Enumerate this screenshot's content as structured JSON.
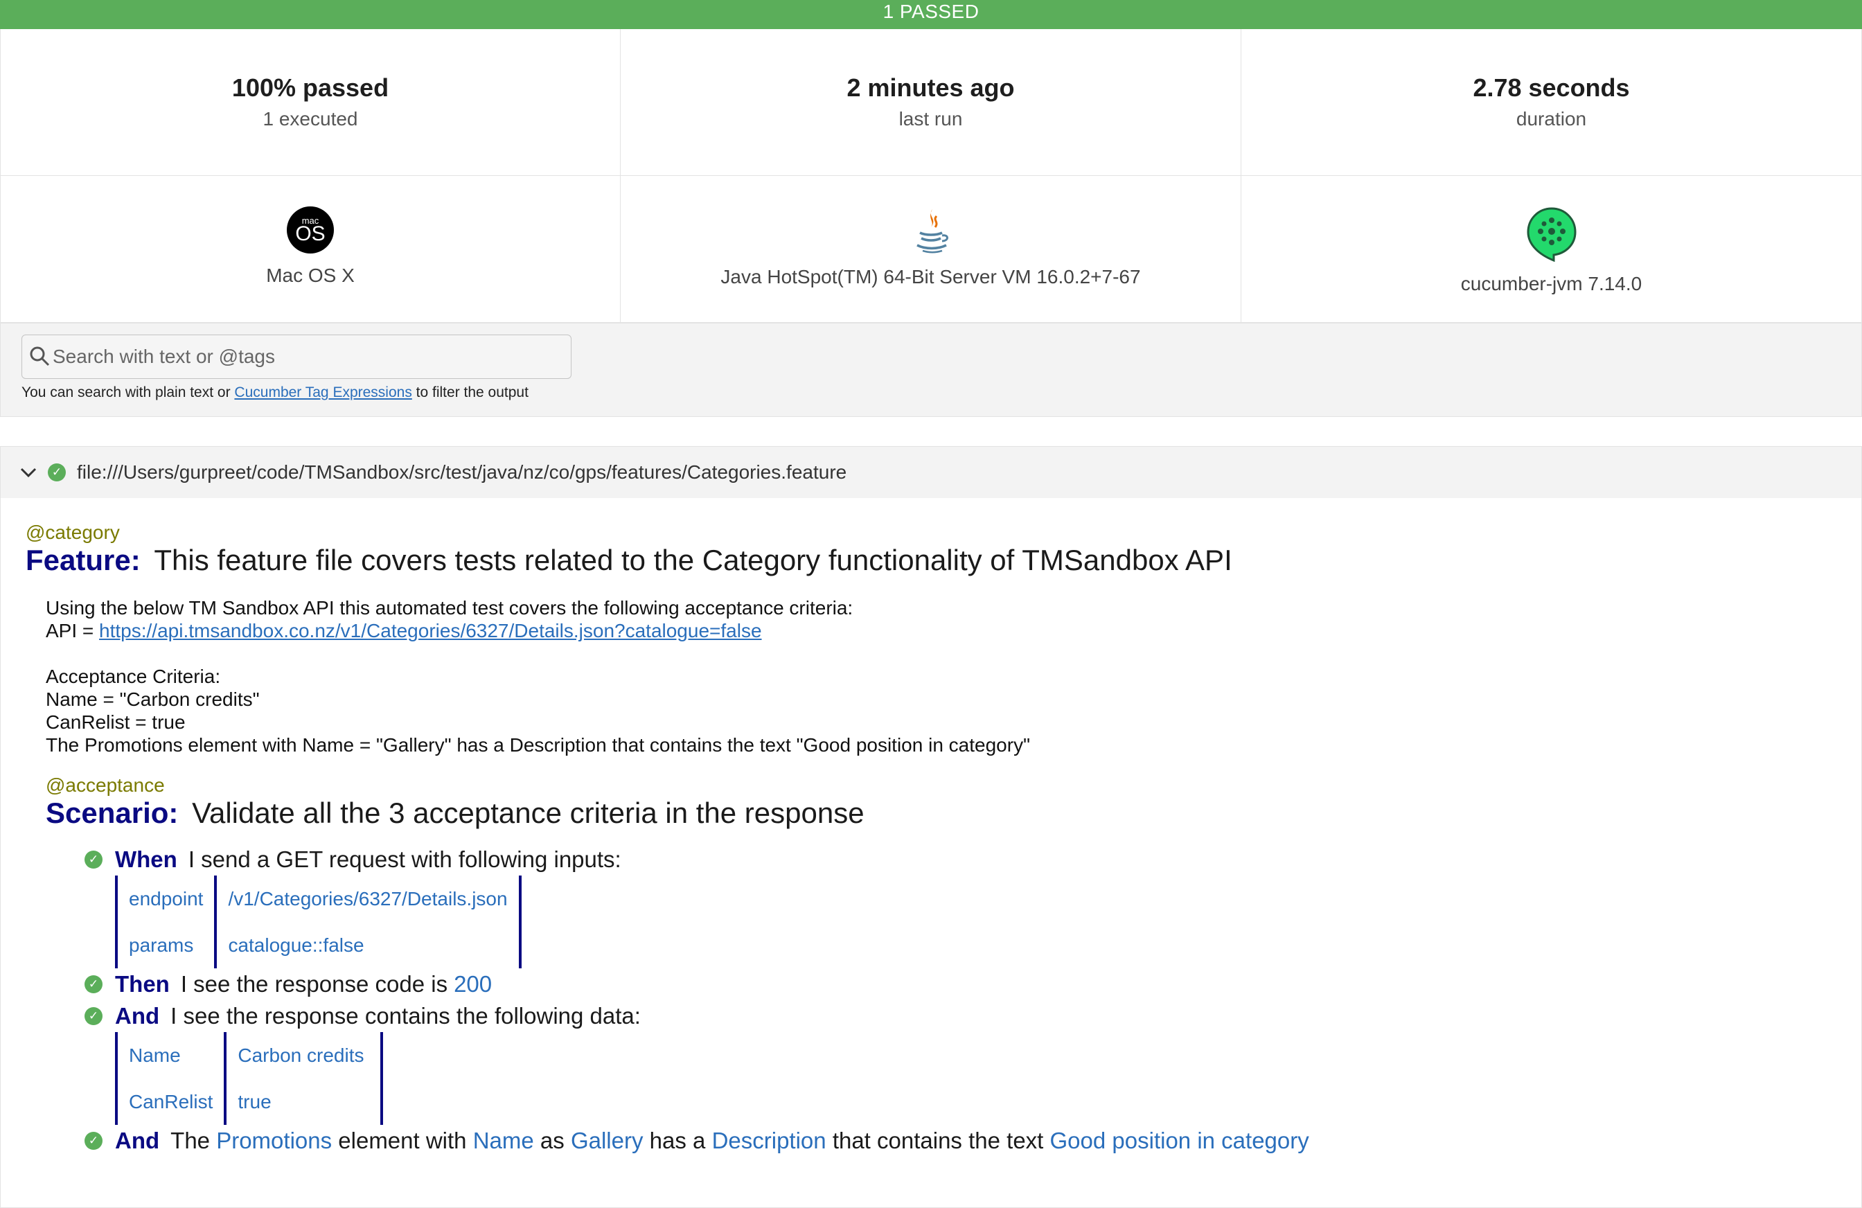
{
  "banner": {
    "label": "1 PASSED",
    "color": "#5bae5a"
  },
  "stats": [
    {
      "value": "100% passed",
      "label": "1 executed"
    },
    {
      "value": "2 minutes ago",
      "label": "last run"
    },
    {
      "value": "2.78 seconds",
      "label": "duration"
    }
  ],
  "env": {
    "os": {
      "icon": "macos-icon",
      "icon_small": "mac",
      "icon_big": "OS",
      "label": "Mac OS X"
    },
    "runtime": {
      "icon": "java-icon",
      "label": "Java HotSpot(TM) 64-Bit Server VM 16.0.2+7-67"
    },
    "tool": {
      "icon": "cucumber-icon",
      "label": "cucumber-jvm 7.14.0"
    }
  },
  "search": {
    "placeholder": "Search with text or @tags",
    "hint_before": "You can search with plain text or",
    "hint_link": "Cucumber Tag Expressions",
    "hint_after": "to filter the output"
  },
  "feature": {
    "file": "file:///Users/gurpreet/code/TMSandbox/src/test/java/nz/co/gps/features/Categories.feature",
    "tag": "@category",
    "keyword": "Feature:",
    "title": "This feature file covers tests related to the Category functionality of TMSandbox API",
    "description": {
      "line1": "Using the below TM Sandbox API this automated test covers the following acceptance criteria:",
      "api_prefix": "API =",
      "api_url": "https://api.tmsandbox.co.nz/v1/Categories/6327/Details.json?catalogue=false",
      "ac_heading": "Acceptance Criteria:",
      "ac1": "Name = \"Carbon credits\"",
      "ac2": "CanRelist = true",
      "ac3": "The Promotions element with Name = \"Gallery\" has a Description that contains the text \"Good position in category\""
    }
  },
  "scenario": {
    "tag": "@acceptance",
    "keyword": "Scenario:",
    "title": "Validate all the 3 acceptance criteria in the response",
    "steps": {
      "s1": {
        "keyword": "When",
        "text": "I send a GET request with following inputs:"
      },
      "t1": [
        [
          "endpoint",
          "/v1/Categories/6327/Details.json"
        ],
        [
          "params",
          "catalogue::false"
        ]
      ],
      "s2": {
        "keyword": "Then",
        "text": "I see the response code is",
        "param": "200"
      },
      "s3": {
        "keyword": "And",
        "text": "I see the response contains the following data:"
      },
      "t2": [
        [
          "Name",
          "Carbon credits"
        ],
        [
          "CanRelist",
          "true"
        ]
      ],
      "s4": {
        "keyword": "And",
        "parts": [
          "The",
          "Promotions",
          "element with",
          "Name",
          "as",
          "Gallery",
          "has a",
          "Description",
          "that contains the text",
          "Good position in category"
        ]
      }
    }
  }
}
